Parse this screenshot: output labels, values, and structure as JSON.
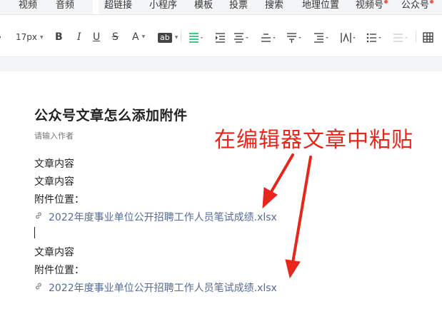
{
  "insert_menu": {
    "items": [
      "视频",
      "音频",
      "超链接",
      "小程序",
      "模板",
      "投票",
      "搜索",
      "地理位置",
      "视频号",
      "公众号"
    ]
  },
  "format_toolbar": {
    "font_size": "17px",
    "bold": "B",
    "italic": "I",
    "underline": "U",
    "strikethrough": "S",
    "font_color": "A",
    "background_color": "ab",
    "icons": [
      "align-icon",
      "indent-icon",
      "justify-icon",
      "line-spacing-icon",
      "paragraph-spacing-icon",
      "list-spacing-icon",
      "letter-spacing-icon",
      "bulleted-list-icon",
      "numbered-list-icon",
      "table-icon"
    ]
  },
  "editor": {
    "title": "公众号文章怎么添加附件",
    "author_placeholder": "请输入作者",
    "blocks": {
      "p1": "文章内容",
      "p2": "文章内容",
      "p3": "附件位置：",
      "attachment1": "2022年度事业单位公开招聘工作人员笔试成绩.xlsx",
      "p4": "文章内容",
      "p5": "附件位置：",
      "attachment2": "2022年度事业单位公开招聘工作人员笔试成绩.xlsx"
    }
  },
  "annotation": {
    "text": "在编辑器文章中粘贴",
    "color": "#e8271b"
  },
  "colors": {
    "link": "#576b95",
    "active_tool": "#07c160",
    "badge": "#fa5151"
  }
}
